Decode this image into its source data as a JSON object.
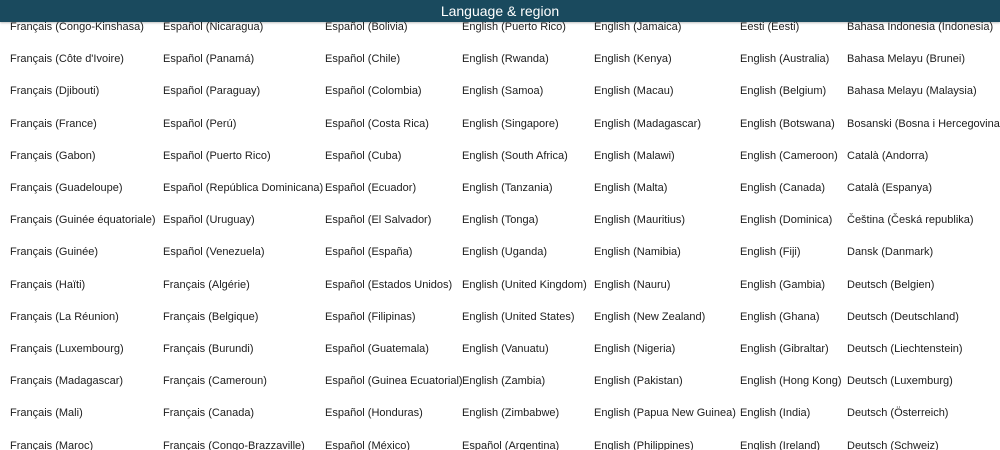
{
  "window": {
    "title": "Language & region"
  },
  "columns": [
    [
      "Français (Congo-Kinshasa)",
      "Français (Côte d'Ivoire)",
      "Français (Djibouti)",
      "Français (France)",
      "Français (Gabon)",
      "Français (Guadeloupe)",
      "Français (Guinée équatoriale)",
      "Français (Guinée)",
      "Français (Haïti)",
      "Français (La Réunion)",
      "Français (Luxembourg)",
      "Français (Madagascar)",
      "Français (Mali)",
      "Français (Maroc)"
    ],
    [
      "Español (Nicaragua)",
      "Español (Panamá)",
      "Español (Paraguay)",
      "Español (Perú)",
      "Español (Puerto Rico)",
      "Español (República Dominicana)",
      "Español (Uruguay)",
      "Español (Venezuela)",
      "Français (Algérie)",
      "Français (Belgique)",
      "Français (Burundi)",
      "Français (Cameroun)",
      "Français (Canada)",
      "Français (Congo-Brazzaville)"
    ],
    [
      "Español (Bolivia)",
      "Español (Chile)",
      "Español (Colombia)",
      "Español (Costa Rica)",
      "Español (Cuba)",
      "Español (Ecuador)",
      "Español (El Salvador)",
      "Español (España)",
      "Español (Estados Unidos)",
      "Español (Filipinas)",
      "Español (Guatemala)",
      "Español (Guinea Ecuatorial)",
      "Español (Honduras)",
      "Español (México)"
    ],
    [
      "English (Puerto Rico)",
      "English (Rwanda)",
      "English (Samoa)",
      "English (Singapore)",
      "English (South Africa)",
      "English (Tanzania)",
      "English (Tonga)",
      "English (Uganda)",
      "English (United Kingdom)",
      "English (United States)",
      "English (Vanuatu)",
      "English (Zambia)",
      "English (Zimbabwe)",
      "Español (Argentina)"
    ],
    [
      "English (Jamaica)",
      "English (Kenya)",
      "English (Macau)",
      "English (Madagascar)",
      "English (Malawi)",
      "English (Malta)",
      "English (Mauritius)",
      "English (Namibia)",
      "English (Nauru)",
      "English (New Zealand)",
      "English (Nigeria)",
      "English (Pakistan)",
      "English (Papua New Guinea)",
      "English (Philippines)"
    ],
    [
      "Eesti (Eesti)",
      "English (Australia)",
      "English (Belgium)",
      "English (Botswana)",
      "English (Cameroon)",
      "English (Canada)",
      "English (Dominica)",
      "English (Fiji)",
      "English (Gambia)",
      "English (Ghana)",
      "English (Gibraltar)",
      "English (Hong Kong)",
      "English (India)",
      "English (Ireland)"
    ],
    [
      "Bahasa Indonesia (Indonesia)",
      "Bahasa Melayu (Brunei)",
      "Bahasa Melayu (Malaysia)",
      "Bosanski (Bosna i Hercegovina)",
      "Català (Andorra)",
      "Català (Espanya)",
      "Čeština (Česká republika)",
      "Dansk (Danmark)",
      "Deutsch (Belgien)",
      "Deutsch (Deutschland)",
      "Deutsch (Liechtenstein)",
      "Deutsch (Luxemburg)",
      "Deutsch (Österreich)",
      "Deutsch (Schweiz)"
    ]
  ]
}
